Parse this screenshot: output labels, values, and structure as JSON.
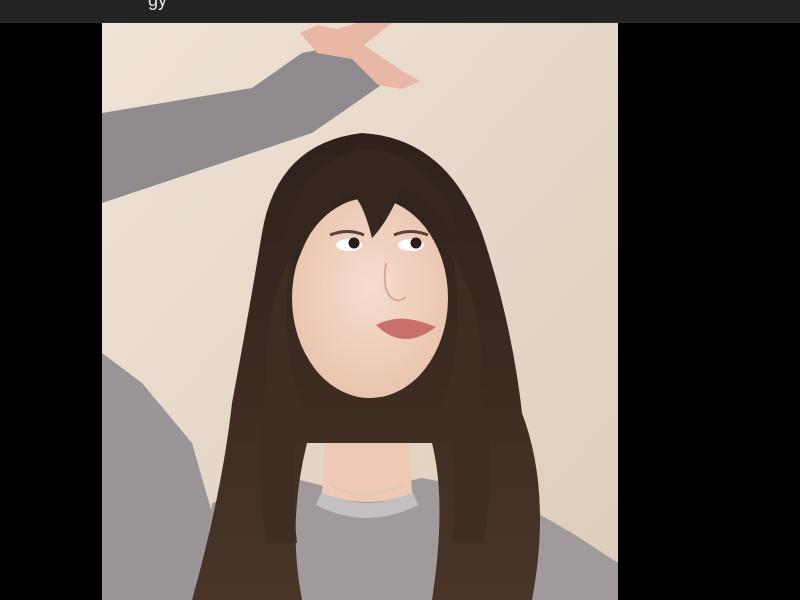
{
  "window": {
    "title_fragment": "gy"
  },
  "photo": {
    "subject": "selfie-portrait",
    "background_color": "#e9dccd",
    "letterbox_color": "#000000"
  },
  "colors": {
    "title_bar": "#232323",
    "hair": "#3b2a22",
    "sweater": "#8f8a8d",
    "skin": "#f1d2c0",
    "lips": "#c9706c"
  },
  "icons": []
}
